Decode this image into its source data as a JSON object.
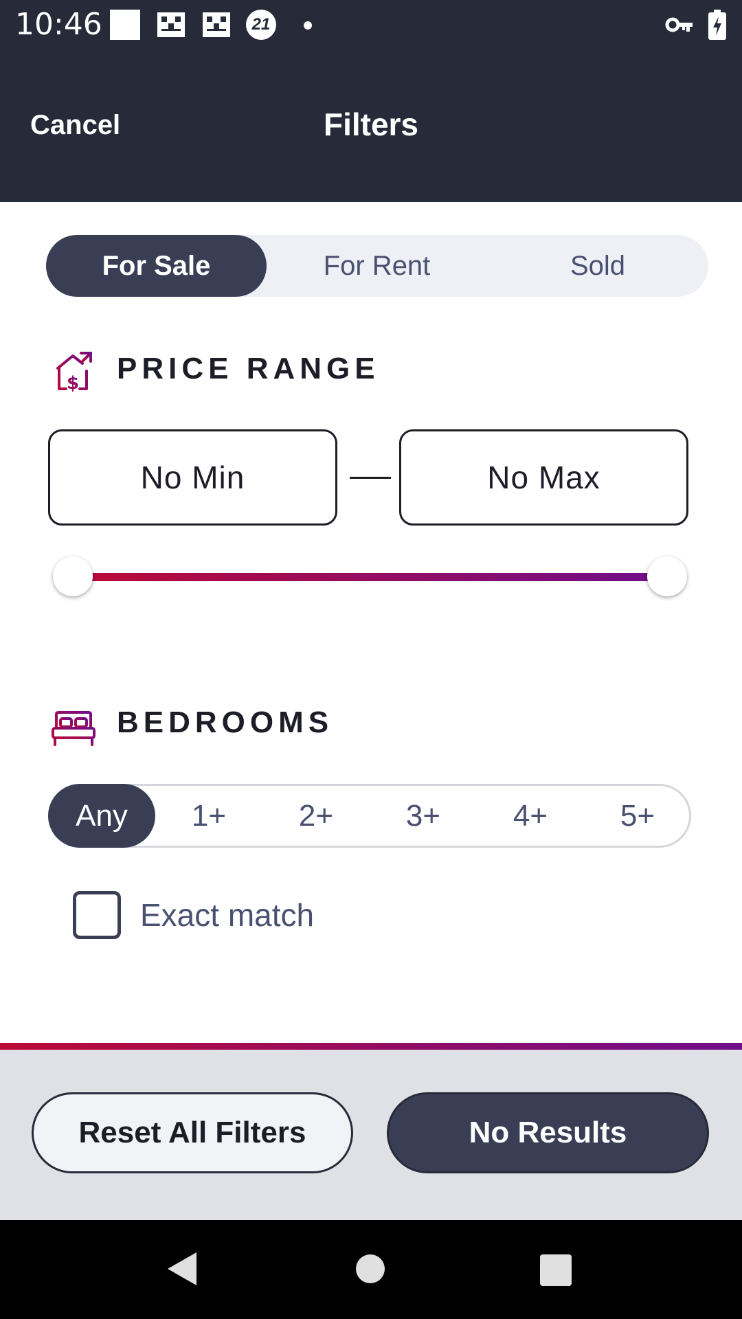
{
  "status_bar": {
    "time": "10:46",
    "notification_badge": "21",
    "icons": [
      "blank-square-icon",
      "grid-icon",
      "grid-icon",
      "badge-21-icon",
      "dot-icon",
      "vpn-key-icon",
      "battery-charging-icon"
    ]
  },
  "app_bar": {
    "cancel_label": "Cancel",
    "title": "Filters"
  },
  "listing_type": {
    "options": [
      "For Sale",
      "For Rent",
      "Sold"
    ],
    "selected": "For Sale"
  },
  "price_range": {
    "title": "PRICE RANGE",
    "icon": "house-dollar-icon",
    "min_label": "No Min",
    "max_label": "No Max",
    "slider_min_fraction": 0,
    "slider_max_fraction": 1
  },
  "bedrooms": {
    "title": "BEDROOMS",
    "icon": "bed-icon",
    "options": [
      "Any",
      "1+",
      "2+",
      "3+",
      "4+",
      "5+"
    ],
    "selected": "Any",
    "exact_match_label": "Exact match",
    "exact_match_checked": false
  },
  "footer": {
    "reset_label": "Reset All Filters",
    "results_label": "No Results"
  },
  "colors": {
    "header_bg": "#272a38",
    "accent_dark": "#3a3e55",
    "gradient_start": "#bb0a36",
    "gradient_end": "#6f0e8a",
    "muted_text": "#4a5070"
  }
}
